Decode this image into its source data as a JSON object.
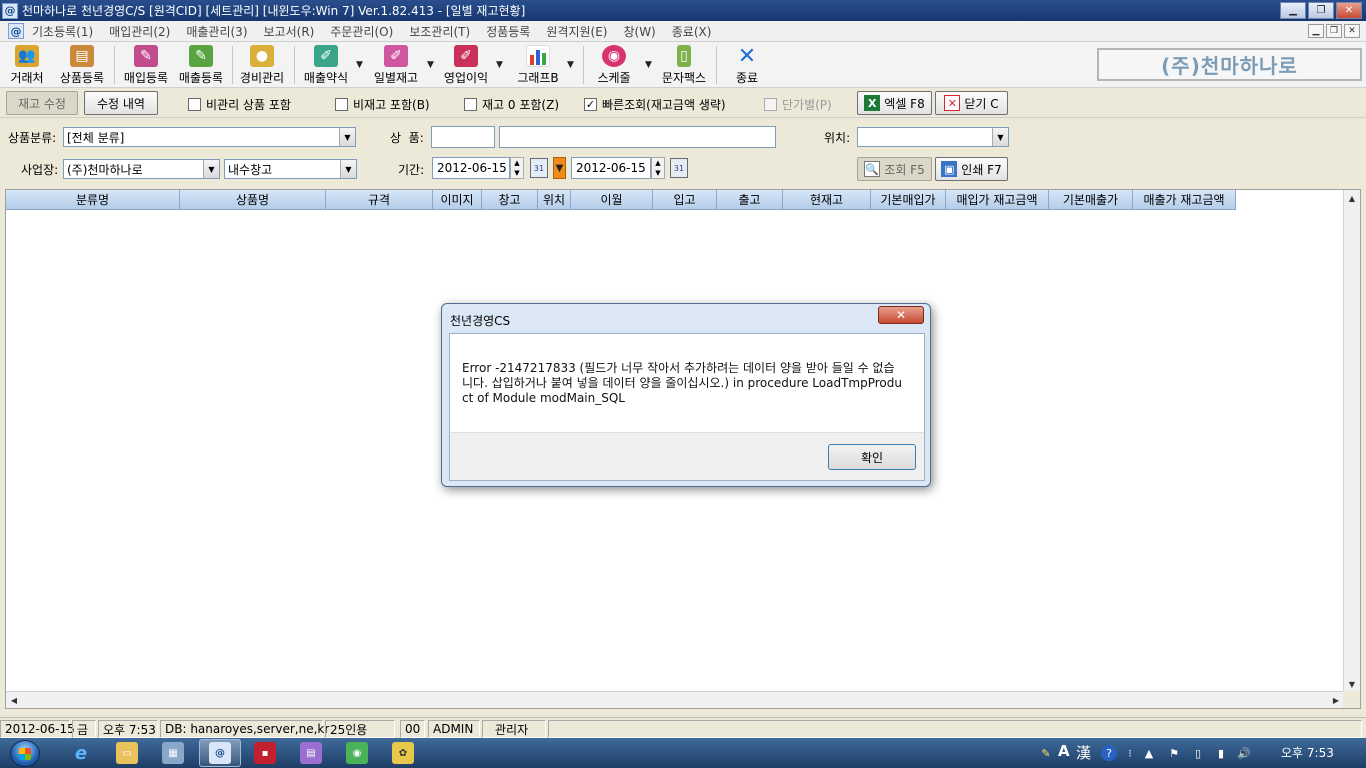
{
  "window": {
    "title": "천마하나로 천년경영C/S [원격CID] [세트관리] [내윈도우:Win 7] Ver.1.82.413 - [일별 재고현황]"
  },
  "menu": {
    "items": [
      "기초등록(1)",
      "매입관리(2)",
      "매출관리(3)",
      "보고서(R)",
      "주문관리(O)",
      "보조관리(T)",
      "정품등록",
      "원격지원(E)",
      "창(W)",
      "종료(X)"
    ]
  },
  "toolbar": {
    "buttons": [
      "거래처",
      "상품등록",
      "매입등록",
      "매출등록",
      "경비관리",
      "매출약식",
      "일별재고",
      "영업이익",
      "그래프B",
      "스케줄",
      "문자팩스",
      "종료"
    ],
    "brand": "(주)천마하나로"
  },
  "options": {
    "stock_edit": "재고 수정",
    "edit_history": "수정 내역",
    "chk_unmanaged": "비관리 상품 포함",
    "chk_nonstock": "비재고 포함(B)",
    "chk_zero_stock": "재고 0 포함(Z)",
    "chk_quick": "빠른조회(재고금액 생략)",
    "chk_unit_price": "단가별(P)",
    "quick_checked": "✓",
    "excel": "엑셀 F8",
    "close": "닫기 C"
  },
  "filters": {
    "category_label": "상품분류:",
    "category_value": "[전체 분류]",
    "product_label": "상  품:",
    "location_label": "위치:",
    "site_label": "사업장:",
    "site_value": "(주)천마하나로",
    "warehouse_value": "내수창고",
    "period_label": "기간:",
    "date_from": "2012-06-15",
    "date_to": "2012-06-15",
    "search": "조회 F5",
    "print": "인쇄 F7"
  },
  "grid": {
    "columns": [
      "분류명",
      "상품명",
      "규격",
      "이미지",
      "창고",
      "위치",
      "이월",
      "입고",
      "출고",
      "현재고",
      "기본매입가",
      "매입가 재고금액",
      "기본매출가",
      "매출가 재고금액"
    ],
    "rows": []
  },
  "status": {
    "date": "2012-06-15",
    "weekday": "금",
    "time": "오후 7:53",
    "db": "DB: hanaroyes,server,ne,kr",
    "users": "25인용",
    "code": "00",
    "user": "ADMIN",
    "role": "관리자"
  },
  "dialog": {
    "title": "천년경영CS",
    "message": "Error -2147217833 (필드가 너무 작아서 추가하려는 데이터 양을 받아 들일 수 없습니다. 삽입하거나 붙여 넣을 데이터 양을 줄이십시오.) in procedure LoadTmpProduct of Module modMain_SQL",
    "ok": "확인"
  },
  "taskbar": {
    "ime_a": "A",
    "ime_han": "漢",
    "clock": "오후 7:53"
  },
  "colors": {
    "title_bar": "#16366f",
    "grid_header": "#b4cde9",
    "accent_orange": "#f08c1c",
    "brand_text": "#7a9cb4"
  }
}
